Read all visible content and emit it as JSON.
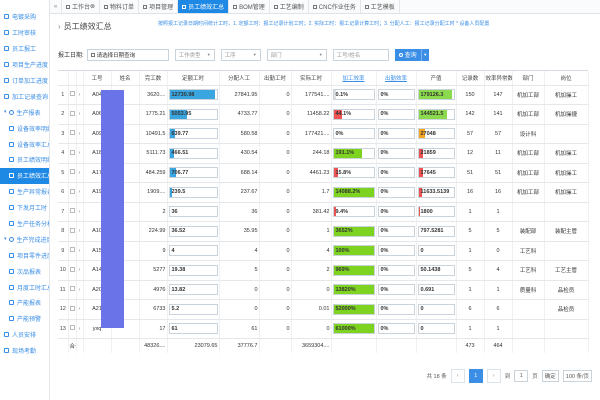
{
  "sidebar": {
    "items": [
      {
        "label": "电镀采购",
        "kind": "top"
      },
      {
        "label": "工时审核",
        "kind": "top"
      },
      {
        "label": "员工报工",
        "kind": "top"
      },
      {
        "label": "项目生产进度",
        "kind": "top"
      },
      {
        "label": "订单加工进度",
        "kind": "top"
      },
      {
        "label": "加工记录查询",
        "kind": "top"
      },
      {
        "label": "生产报表",
        "kind": "group"
      },
      {
        "label": "设备效率明细",
        "kind": "sub"
      },
      {
        "label": "设备效率汇总",
        "kind": "sub"
      },
      {
        "label": "员工绩效明细",
        "kind": "sub"
      },
      {
        "label": "员工绩效汇总",
        "kind": "sub",
        "active": true
      },
      {
        "label": "生产异常报表",
        "kind": "sub"
      },
      {
        "label": "下发月工时",
        "kind": "sub"
      },
      {
        "label": "生产任务分析",
        "kind": "sub"
      },
      {
        "label": "生产完成进度",
        "kind": "group"
      },
      {
        "label": "项目零件进度",
        "kind": "sub"
      },
      {
        "label": "次品报表",
        "kind": "sub"
      },
      {
        "label": "月度工时汇总",
        "kind": "sub"
      },
      {
        "label": "产能报表",
        "kind": "sub"
      },
      {
        "label": "产能预警",
        "kind": "sub"
      },
      {
        "label": "人员安排",
        "kind": "top"
      },
      {
        "label": "现场考勤",
        "kind": "top"
      }
    ]
  },
  "tabs": [
    {
      "label": "工作台",
      "close": true
    },
    {
      "label": "物料订单"
    },
    {
      "label": "项目管理"
    },
    {
      "label": "员工绩效汇总",
      "active": true
    },
    {
      "label": "BOM管理"
    },
    {
      "label": "工艺编制"
    },
    {
      "label": "CNC作业任务"
    },
    {
      "label": "工艺模板"
    }
  ],
  "page": {
    "title": "员工绩效汇总",
    "hint": "按照报工记录日期时间统计工时，1. 定额工时：报工记录计划工时；2. 实际工时：报工记录计算工时；3. 分配人工：报工记录分配工时 * 设备人员配置"
  },
  "filters": {
    "date_label": "报工日期:",
    "date_value": "请选择日期查询",
    "type_placeholder": "工作类型",
    "process_placeholder": "工序",
    "dept_placeholder": "部门",
    "name_placeholder": "工号/姓名",
    "search_label": "查询"
  },
  "columns": [
    "工号",
    "姓名",
    "完工数",
    "定额工时",
    "分配人工",
    "出勤工时",
    "实际工时",
    "加工效率",
    "出勤效率",
    "产值",
    "记录数",
    "效率异常数",
    "部门",
    "岗位"
  ],
  "rows": [
    {
      "idx": "1",
      "id": "A04",
      "qty": "3620....",
      "rated": "12730.98",
      "rated_pct": 96,
      "alloc": "27841.95",
      "attend": "0",
      "actual": "177541....",
      "proc_eff": "0.1%",
      "proc_pct": 5,
      "proc_color": "#e0e0e0",
      "att_eff": "0%",
      "output": "179126.3",
      "out_pct": 95,
      "out_color": "#8bd94c",
      "recs": "150",
      "abn": "147",
      "dept": "机加工部",
      "post": "机加操工"
    },
    {
      "idx": "2",
      "id": "A06",
      "qty": "1775.21",
      "rated": "5053.95",
      "rated_pct": 38,
      "alloc": "4733.77",
      "attend": "0",
      "actual": "11458.22",
      "proc_eff": "44.1%",
      "proc_pct": 22,
      "proc_color": "#f05353",
      "att_eff": "0%",
      "output": "144521.5",
      "out_pct": 80,
      "out_color": "#8bd94c",
      "recs": "142",
      "abn": "141",
      "dept": "机加工部",
      "post": "机加操捷"
    },
    {
      "idx": "3",
      "id": "A09",
      "qty": "10491.5",
      "rated": "639.77",
      "rated_pct": 12,
      "alloc": "580.58",
      "attend": "0",
      "actual": "177421....",
      "proc_eff": "0%",
      "proc_pct": 0,
      "proc_color": "#e0e0e0",
      "att_eff": "0%",
      "output": "27048",
      "out_pct": 18,
      "out_color": "#f5a623",
      "recs": "57",
      "abn": "57",
      "dept": "设计科",
      "post": ""
    },
    {
      "idx": "4",
      "id": "A18",
      "qty": "5111.73",
      "rated": "466.51",
      "rated_pct": 10,
      "alloc": "430.54",
      "attend": "0",
      "actual": "244.18",
      "proc_eff": "191.1%",
      "proc_pct": 70,
      "proc_color": "#7ed321",
      "att_eff": "0%",
      "output": "21859",
      "out_pct": 14,
      "out_color": "#f05353",
      "recs": "12",
      "abn": "11",
      "dept": "机加工部",
      "post": "机加操工"
    },
    {
      "idx": "5",
      "id": "A17",
      "qty": "484.259",
      "rated": "706.77",
      "rated_pct": 13,
      "alloc": "688.14",
      "attend": "0",
      "actual": "4461.23",
      "proc_eff": "15.8%",
      "proc_pct": 10,
      "proc_color": "#f05353",
      "att_eff": "0%",
      "output": "17645",
      "out_pct": 12,
      "out_color": "#f05353",
      "recs": "51",
      "abn": "51",
      "dept": "机加工部",
      "post": "机加操工"
    },
    {
      "idx": "6",
      "id": "A19",
      "qty": "1909....",
      "rated": "239.5",
      "rated_pct": 6,
      "alloc": "237.67",
      "attend": "0",
      "actual": "1.7",
      "proc_eff": "14088.2%",
      "proc_pct": 100,
      "proc_color": "#7ed321",
      "att_eff": "0%",
      "output": "11633.5139",
      "out_pct": 10,
      "out_color": "#f05353",
      "recs": "16",
      "abn": "16",
      "dept": "机加工部",
      "post": "机加操工"
    },
    {
      "idx": "7",
      "id": "",
      "qty": "2",
      "rated": "36",
      "rated_pct": 0,
      "alloc": "36",
      "attend": "0",
      "actual": "381.42",
      "proc_eff": "9.4%",
      "proc_pct": 6,
      "proc_color": "#f05353",
      "att_eff": "0%",
      "output": "1800",
      "out_pct": 3,
      "out_color": "#f05353",
      "recs": "1",
      "abn": "1",
      "dept": "",
      "post": ""
    },
    {
      "idx": "8",
      "id": "A10",
      "qty": "224.99",
      "rated": "36.52",
      "rated_pct": 0,
      "alloc": "35.95",
      "attend": "0",
      "actual": "1",
      "proc_eff": "3652%",
      "proc_pct": 100,
      "proc_color": "#7ed321",
      "att_eff": "0%",
      "output": "797.5281",
      "out_pct": 0,
      "out_color": "#e0e0e0",
      "recs": "5",
      "abn": "5",
      "dept": "装配部",
      "post": "装配主管"
    },
    {
      "idx": "9",
      "id": "A15",
      "qty": "9",
      "rated": "4",
      "rated_pct": 0,
      "alloc": "4",
      "attend": "0",
      "actual": "4",
      "proc_eff": "100%",
      "proc_pct": 100,
      "proc_color": "#7ed321",
      "att_eff": "0%",
      "output": "0",
      "out_pct": 0,
      "out_color": "#e0e0e0",
      "recs": "1",
      "abn": "0",
      "dept": "工艺科",
      "post": ""
    },
    {
      "idx": "10",
      "id": "A14",
      "qty": "5277",
      "rated": "19.38",
      "rated_pct": 0,
      "alloc": "5",
      "attend": "0",
      "actual": "2",
      "proc_eff": "969%",
      "proc_pct": 100,
      "proc_color": "#7ed321",
      "att_eff": "0%",
      "output": "50.1438",
      "out_pct": 0,
      "out_color": "#e0e0e0",
      "recs": "5",
      "abn": "4",
      "dept": "工艺科",
      "post": "工艺主管"
    },
    {
      "idx": "11",
      "id": "A20",
      "qty": "4976",
      "rated": "13.82",
      "rated_pct": 0,
      "alloc": "0",
      "attend": "0",
      "actual": "0",
      "proc_eff": "13820%",
      "proc_pct": 100,
      "proc_color": "#7ed321",
      "att_eff": "0%",
      "output": "0.691",
      "out_pct": 0,
      "out_color": "#e0e0e0",
      "recs": "1",
      "abn": "1",
      "dept": "质量科",
      "post": "品检员"
    },
    {
      "idx": "12",
      "id": "A21",
      "qty": "6733",
      "rated": "5.2",
      "rated_pct": 0,
      "alloc": "0",
      "attend": "0",
      "actual": "0.01",
      "proc_eff": "52000%",
      "proc_pct": 100,
      "proc_color": "#7ed321",
      "att_eff": "0%",
      "output": "0",
      "out_pct": 0,
      "out_color": "#e0e0e0",
      "recs": "6",
      "abn": "6",
      "dept": "",
      "post": "品检员"
    },
    {
      "idx": "13",
      "id": "yxq",
      "qty": "17",
      "rated": "61",
      "rated_pct": 0,
      "alloc": "61",
      "attend": "0",
      "actual": "0",
      "proc_eff": "61000%",
      "proc_pct": 100,
      "proc_color": "#7ed321",
      "att_eff": "0%",
      "output": "0",
      "out_pct": 0,
      "out_color": "#e0e0e0",
      "recs": "1",
      "abn": "1",
      "dept": "",
      "post": ""
    }
  ],
  "footer": {
    "label": "合计",
    "qty": "48326....",
    "rated": "23079.65",
    "alloc": "37776.7",
    "actual": "3659304....",
    "recs": "473",
    "abn": "464"
  },
  "pager": {
    "total": "共 18 条",
    "prev": "‹",
    "current": "1",
    "next": "›",
    "goto_label": "到",
    "goto_value": "1",
    "page_unit": "页",
    "confirm": "确定",
    "page_size": "100 条/页"
  },
  "colors": {
    "accent": "#1e88e5",
    "bar_blue": "#3ba5e0",
    "name_mask": "#6a74e8"
  }
}
